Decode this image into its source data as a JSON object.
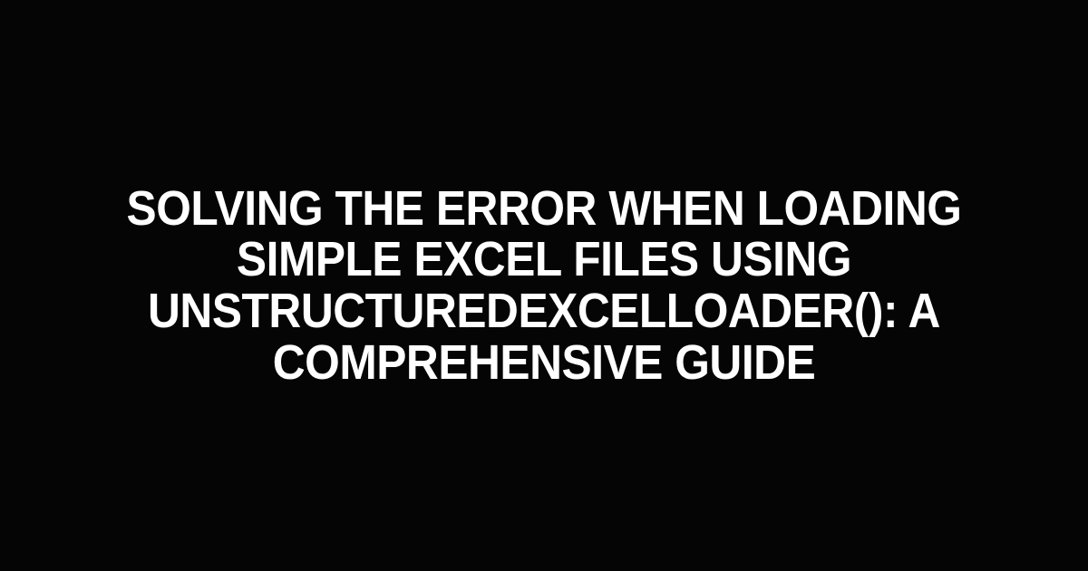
{
  "title": "Solving the Error When Loading Simple Excel Files Using UnstructuredExcelLoader(): A Comprehensive Guide"
}
